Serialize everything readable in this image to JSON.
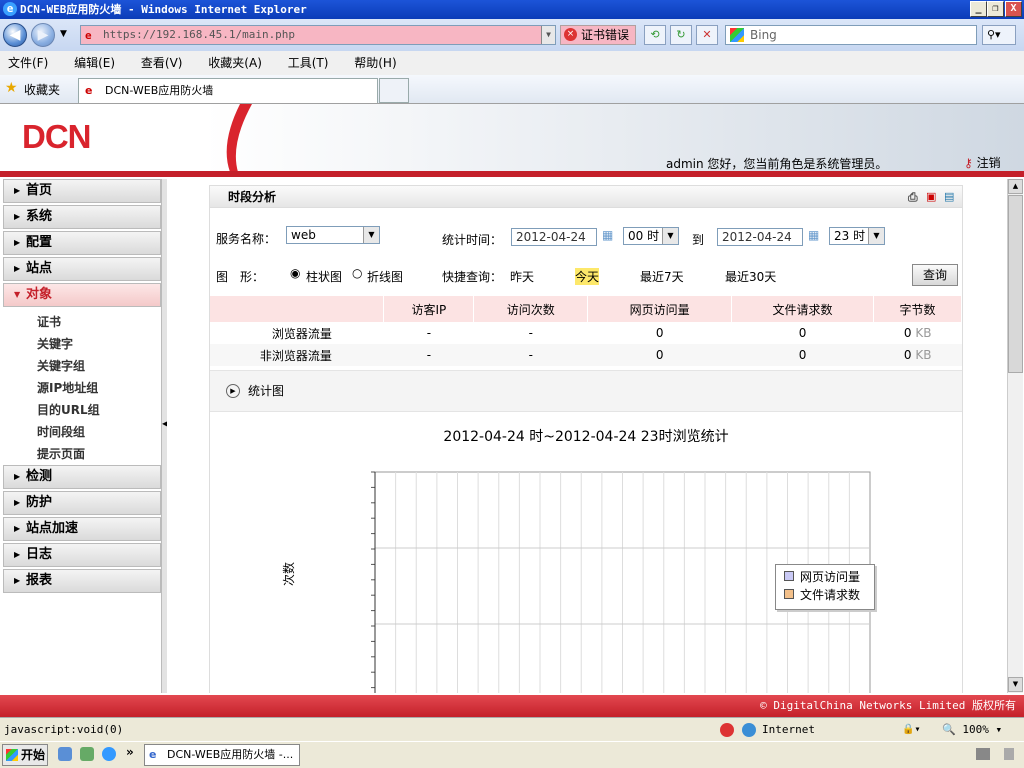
{
  "window": {
    "title": "DCN-WEB应用防火墙 - Windows Internet Explorer",
    "min": "_",
    "max": "❐",
    "close": "X"
  },
  "nav": {
    "url": "https://192.168.45.1/main.php",
    "cert_error": "证书错误",
    "search_placeholder": "Bing"
  },
  "menu": [
    "文件(F)",
    "编辑(E)",
    "查看(V)",
    "收藏夹(A)",
    "工具(T)",
    "帮助(H)"
  ],
  "favorites": {
    "label": "收藏夹",
    "tab_title": "DCN-WEB应用防火墙"
  },
  "header": {
    "logo": "DCN",
    "welcome": "admin 您好，您当前角色是系统管理员。",
    "logout": "注销"
  },
  "sidebar": {
    "items": [
      {
        "label": "首页"
      },
      {
        "label": "系统"
      },
      {
        "label": "配置"
      },
      {
        "label": "站点"
      },
      {
        "label": "对象"
      },
      {
        "label": "检测"
      },
      {
        "label": "防护"
      },
      {
        "label": "站点加速"
      },
      {
        "label": "日志"
      },
      {
        "label": "报表"
      }
    ],
    "subitems": [
      "证书",
      "关键字",
      "关键字组",
      "源IP地址组",
      "目的URL组",
      "时间段组",
      "提示页面"
    ]
  },
  "panel": {
    "title": "时段分析",
    "service_label": "服务名称：",
    "service_value": "web",
    "time_label": "统计时间：",
    "start_date": "2012-04-24",
    "start_hour": "00 时",
    "to": "到",
    "end_date": "2012-04-24",
    "end_hour": "23 时",
    "shape_label": "图　形：",
    "bar_option": "柱状图",
    "line_option": "折线图",
    "quick_label": "快捷查询：",
    "quick": [
      "昨天",
      "今天",
      "最近7天",
      "最近30天"
    ],
    "query_button": "查询",
    "columns": [
      "",
      "访客IP",
      "访问次数",
      "网页访问量",
      "文件请求数",
      "字节数"
    ],
    "rows": [
      {
        "name": "浏览器流量",
        "ip": "-",
        "visits": "-",
        "pages": "0",
        "files": "0",
        "bytes": "0",
        "unit": "KB"
      },
      {
        "name": "非浏览器流量",
        "ip": "-",
        "visits": "-",
        "pages": "0",
        "files": "0",
        "bytes": "0",
        "unit": "KB"
      }
    ],
    "chart_section": "统计图"
  },
  "chart_data": {
    "type": "bar",
    "title": "2012-04-24 时~2012-04-24 23时浏览统计",
    "ylabel": "次数",
    "series": [
      {
        "name": "网页访问量",
        "color": "#c9c9f5",
        "values": []
      },
      {
        "name": "文件请求数",
        "color": "#f3c08a",
        "values": []
      }
    ],
    "grid": true,
    "legend": "right"
  },
  "footer": "© DigitalChina Networks Limited 版权所有",
  "status": {
    "text": "javascript:void(0)",
    "zone": "Internet",
    "zoom": "100%"
  },
  "taskbar": {
    "start": "开始",
    "task": "DCN-WEB应用防火墙 -..."
  }
}
